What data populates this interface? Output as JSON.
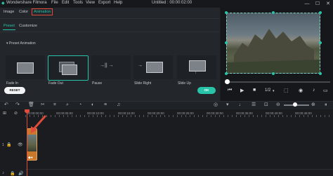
{
  "window": {
    "app_title": "Wondershare Filmora",
    "menu": [
      "File",
      "Edit",
      "Tools",
      "View",
      "Export",
      "Help"
    ],
    "project_title": "Untitled : 00:00:02:00",
    "controls": [
      "—",
      "☐",
      "✕"
    ]
  },
  "left_panel": {
    "tabs": [
      "Image",
      "Color",
      "Animation"
    ],
    "subtabs": [
      "Preset",
      "Customize"
    ],
    "section_title": "▾  Preset Animation",
    "presets": [
      {
        "label": "Fade In"
      },
      {
        "label": "Fade Out"
      },
      {
        "label": "Pause"
      },
      {
        "label": "Slide Right"
      },
      {
        "label": "Slide Up"
      }
    ],
    "reset_label": "RESET",
    "ok_label": "OK"
  },
  "preview": {
    "page_indicator": "1/2",
    "controls": [
      "⏮",
      "▶",
      "■",
      "▾"
    ]
  },
  "timeline": {
    "ruler_labels": [
      "00:00:00:00",
      "00:00:05:00",
      "00:00:10:00",
      "00:00:15:00",
      "00:00:20:00",
      "00:00:25:00",
      "00:00:30:00",
      "00:00:35:00",
      "00:00:40:00",
      "00:00:45:00"
    ],
    "track_number": "1"
  },
  "colors": {
    "accent": "#27c4a9",
    "highlight": "#e04b3a",
    "clip": "#c8772b"
  }
}
